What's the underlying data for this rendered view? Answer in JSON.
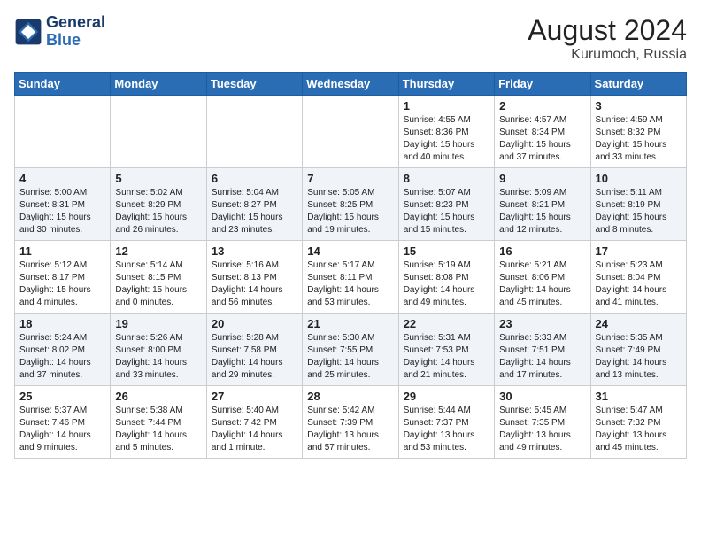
{
  "header": {
    "logo_line1": "General",
    "logo_line2": "Blue",
    "month_year": "August 2024",
    "location": "Kurumoch, Russia"
  },
  "weekdays": [
    "Sunday",
    "Monday",
    "Tuesday",
    "Wednesday",
    "Thursday",
    "Friday",
    "Saturday"
  ],
  "weeks": [
    [
      {
        "day": "",
        "info": ""
      },
      {
        "day": "",
        "info": ""
      },
      {
        "day": "",
        "info": ""
      },
      {
        "day": "",
        "info": ""
      },
      {
        "day": "1",
        "info": "Sunrise: 4:55 AM\nSunset: 8:36 PM\nDaylight: 15 hours\nand 40 minutes."
      },
      {
        "day": "2",
        "info": "Sunrise: 4:57 AM\nSunset: 8:34 PM\nDaylight: 15 hours\nand 37 minutes."
      },
      {
        "day": "3",
        "info": "Sunrise: 4:59 AM\nSunset: 8:32 PM\nDaylight: 15 hours\nand 33 minutes."
      }
    ],
    [
      {
        "day": "4",
        "info": "Sunrise: 5:00 AM\nSunset: 8:31 PM\nDaylight: 15 hours\nand 30 minutes."
      },
      {
        "day": "5",
        "info": "Sunrise: 5:02 AM\nSunset: 8:29 PM\nDaylight: 15 hours\nand 26 minutes."
      },
      {
        "day": "6",
        "info": "Sunrise: 5:04 AM\nSunset: 8:27 PM\nDaylight: 15 hours\nand 23 minutes."
      },
      {
        "day": "7",
        "info": "Sunrise: 5:05 AM\nSunset: 8:25 PM\nDaylight: 15 hours\nand 19 minutes."
      },
      {
        "day": "8",
        "info": "Sunrise: 5:07 AM\nSunset: 8:23 PM\nDaylight: 15 hours\nand 15 minutes."
      },
      {
        "day": "9",
        "info": "Sunrise: 5:09 AM\nSunset: 8:21 PM\nDaylight: 15 hours\nand 12 minutes."
      },
      {
        "day": "10",
        "info": "Sunrise: 5:11 AM\nSunset: 8:19 PM\nDaylight: 15 hours\nand 8 minutes."
      }
    ],
    [
      {
        "day": "11",
        "info": "Sunrise: 5:12 AM\nSunset: 8:17 PM\nDaylight: 15 hours\nand 4 minutes."
      },
      {
        "day": "12",
        "info": "Sunrise: 5:14 AM\nSunset: 8:15 PM\nDaylight: 15 hours\nand 0 minutes."
      },
      {
        "day": "13",
        "info": "Sunrise: 5:16 AM\nSunset: 8:13 PM\nDaylight: 14 hours\nand 56 minutes."
      },
      {
        "day": "14",
        "info": "Sunrise: 5:17 AM\nSunset: 8:11 PM\nDaylight: 14 hours\nand 53 minutes."
      },
      {
        "day": "15",
        "info": "Sunrise: 5:19 AM\nSunset: 8:08 PM\nDaylight: 14 hours\nand 49 minutes."
      },
      {
        "day": "16",
        "info": "Sunrise: 5:21 AM\nSunset: 8:06 PM\nDaylight: 14 hours\nand 45 minutes."
      },
      {
        "day": "17",
        "info": "Sunrise: 5:23 AM\nSunset: 8:04 PM\nDaylight: 14 hours\nand 41 minutes."
      }
    ],
    [
      {
        "day": "18",
        "info": "Sunrise: 5:24 AM\nSunset: 8:02 PM\nDaylight: 14 hours\nand 37 minutes."
      },
      {
        "day": "19",
        "info": "Sunrise: 5:26 AM\nSunset: 8:00 PM\nDaylight: 14 hours\nand 33 minutes."
      },
      {
        "day": "20",
        "info": "Sunrise: 5:28 AM\nSunset: 7:58 PM\nDaylight: 14 hours\nand 29 minutes."
      },
      {
        "day": "21",
        "info": "Sunrise: 5:30 AM\nSunset: 7:55 PM\nDaylight: 14 hours\nand 25 minutes."
      },
      {
        "day": "22",
        "info": "Sunrise: 5:31 AM\nSunset: 7:53 PM\nDaylight: 14 hours\nand 21 minutes."
      },
      {
        "day": "23",
        "info": "Sunrise: 5:33 AM\nSunset: 7:51 PM\nDaylight: 14 hours\nand 17 minutes."
      },
      {
        "day": "24",
        "info": "Sunrise: 5:35 AM\nSunset: 7:49 PM\nDaylight: 14 hours\nand 13 minutes."
      }
    ],
    [
      {
        "day": "25",
        "info": "Sunrise: 5:37 AM\nSunset: 7:46 PM\nDaylight: 14 hours\nand 9 minutes."
      },
      {
        "day": "26",
        "info": "Sunrise: 5:38 AM\nSunset: 7:44 PM\nDaylight: 14 hours\nand 5 minutes."
      },
      {
        "day": "27",
        "info": "Sunrise: 5:40 AM\nSunset: 7:42 PM\nDaylight: 14 hours\nand 1 minute."
      },
      {
        "day": "28",
        "info": "Sunrise: 5:42 AM\nSunset: 7:39 PM\nDaylight: 13 hours\nand 57 minutes."
      },
      {
        "day": "29",
        "info": "Sunrise: 5:44 AM\nSunset: 7:37 PM\nDaylight: 13 hours\nand 53 minutes."
      },
      {
        "day": "30",
        "info": "Sunrise: 5:45 AM\nSunset: 7:35 PM\nDaylight: 13 hours\nand 49 minutes."
      },
      {
        "day": "31",
        "info": "Sunrise: 5:47 AM\nSunset: 7:32 PM\nDaylight: 13 hours\nand 45 minutes."
      }
    ]
  ]
}
